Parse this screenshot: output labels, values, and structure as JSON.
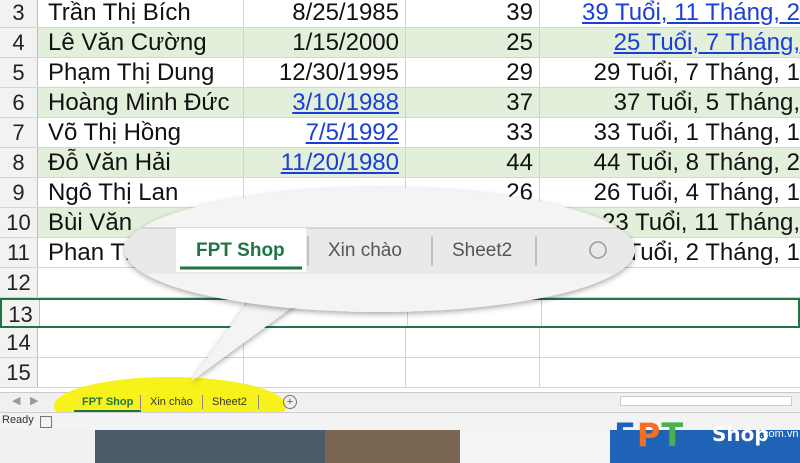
{
  "rows": [
    {
      "num": "3",
      "name": "Trần Thị Bích",
      "date": "8/25/1985",
      "date_link": false,
      "age": "39",
      "desc": "39 Tuổi, 11 Tháng, 2",
      "desc_link": true,
      "band": false
    },
    {
      "num": "4",
      "name": "Lê Văn Cường",
      "date": "1/15/2000",
      "date_link": false,
      "age": "25",
      "desc": "25 Tuổi, 7 Tháng,",
      "desc_link": true,
      "band": true
    },
    {
      "num": "5",
      "name": "Phạm Thị Dung",
      "date": "12/30/1995",
      "date_link": false,
      "age": "29",
      "desc": "29 Tuổi, 7 Tháng, 1",
      "desc_link": false,
      "band": false
    },
    {
      "num": "6",
      "name": "Hoàng Minh Đức",
      "date": "3/10/1988",
      "date_link": true,
      "age": "37",
      "desc": "37 Tuổi, 5 Tháng,",
      "desc_link": false,
      "band": true
    },
    {
      "num": "7",
      "name": "Võ Thị Hồng",
      "date": "7/5/1992",
      "date_link": true,
      "age": "33",
      "desc": "33 Tuổi, 1 Tháng, 1",
      "desc_link": false,
      "band": false
    },
    {
      "num": "8",
      "name": "Đỗ Văn Hải",
      "date": "11/20/1980",
      "date_link": true,
      "age": "44",
      "desc": "44 Tuổi, 8 Tháng, 2",
      "desc_link": false,
      "band": true
    },
    {
      "num": "9",
      "name": "Ngô Thị Lan",
      "date": "",
      "date_link": false,
      "age": "26",
      "desc": "26 Tuổi, 4 Tháng, 1",
      "desc_link": false,
      "band": false
    },
    {
      "num": "10",
      "name": "Bùi Văn",
      "date": "",
      "date_link": false,
      "age": "",
      "desc": "23 Tuổi, 11 Tháng,",
      "desc_link": false,
      "band": true
    },
    {
      "num": "11",
      "name": "Phan Thị",
      "date": "",
      "date_link": false,
      "age": "",
      "desc": "28 Tuổi, 2 Tháng, 1",
      "desc_link": false,
      "band": false
    },
    {
      "num": "12",
      "name": "",
      "date": "",
      "date_link": false,
      "age": "",
      "desc": "",
      "desc_link": false,
      "band": false
    },
    {
      "num": "13",
      "name": "",
      "date": "",
      "date_link": false,
      "age": "",
      "desc": "",
      "desc_link": false,
      "band": false,
      "selected": true
    },
    {
      "num": "14",
      "name": "",
      "date": "",
      "date_link": false,
      "age": "",
      "desc": "",
      "desc_link": false,
      "band": false
    },
    {
      "num": "15",
      "name": "",
      "date": "",
      "date_link": false,
      "age": "",
      "desc": "",
      "desc_link": false,
      "band": false
    }
  ],
  "sheet_tabs": [
    "FPT Shop",
    "Xin chào",
    "Sheet2"
  ],
  "active_tab": "FPT Shop",
  "add_sheet_icon": "plus-circle-icon",
  "status": {
    "ready": "Ready"
  },
  "callout": {
    "tabs": [
      "FPT Shop",
      "Xin chào",
      "Sheet2"
    ]
  },
  "logo": {
    "fpt": "FPT",
    "shop": "Shop",
    "domain": ".com.vn"
  },
  "colors": {
    "excel_green": "#217346",
    "band": "#e2efda",
    "link": "#1a3fd6",
    "highlight": "#f7f21a",
    "logo_blue": "#1e63b5",
    "logo_orange": "#f37021",
    "logo_green": "#4caf50"
  }
}
